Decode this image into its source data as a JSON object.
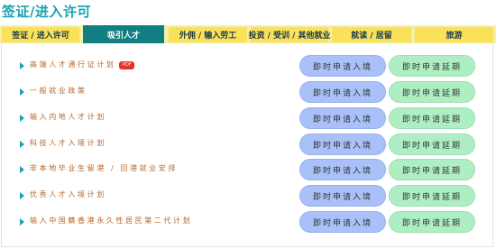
{
  "page_title": "签证/进入许可",
  "tabs": [
    {
      "label": "签证 / 进入许可",
      "active": false
    },
    {
      "label": "吸引人才",
      "active": true
    },
    {
      "label": "外佣 / 输入劳工",
      "active": false
    },
    {
      "label": "投资 / 受训 / 其他就业",
      "active": false
    },
    {
      "label": "就读 / 居留",
      "active": false
    },
    {
      "label": "旅游",
      "active": false
    }
  ],
  "rows": [
    {
      "label": "高端人才通行证计划",
      "pdf_badge": "PDF",
      "entry_button": "即时申请入境",
      "extension_button": "即时申请延期"
    },
    {
      "label": "一般就业政策",
      "entry_button": "即时申请入境",
      "extension_button": "即时申请延期"
    },
    {
      "label": "输入内地人才计划",
      "entry_button": "即时申请入境",
      "extension_button": "即时申请延期"
    },
    {
      "label": "科技人才入境计划",
      "entry_button": "即时申请入境",
      "extension_button": "即时申请延期"
    },
    {
      "label": "非本地毕业生留港 / 回港就业安排",
      "entry_button": "即时申请入境",
      "extension_button": "即时申请延期"
    },
    {
      "label": "优秀人才入境计划",
      "entry_button": "即时申请入境",
      "extension_button": "即时申请延期"
    },
    {
      "label": "输入中国籍香港永久性居民第二代计划",
      "entry_button": "即时申请入境",
      "extension_button": "即时申请延期"
    }
  ],
  "colors": {
    "title": "#17a3b1",
    "tab_bg": "#fbe15a",
    "tab_active_bg": "#117f82",
    "row_text": "#b5662b",
    "entry_button": "#a9c1f8",
    "extension_button": "#aeeec3"
  }
}
